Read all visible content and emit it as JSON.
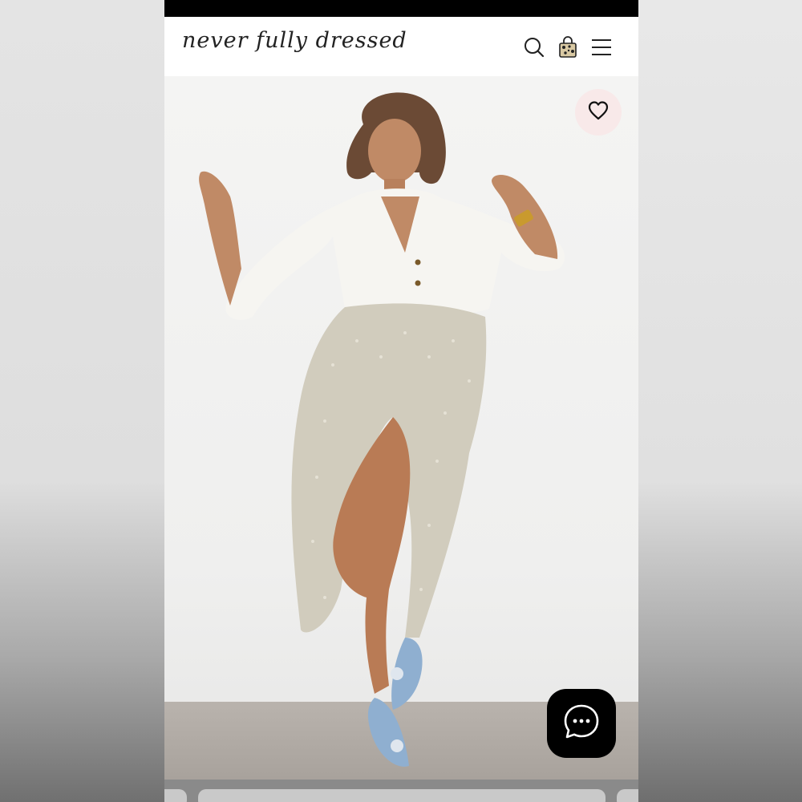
{
  "brand": {
    "logo_text": "never fully dressed"
  },
  "header": {
    "icons": [
      "search-icon",
      "shopping-bag-icon",
      "menu-icon"
    ]
  },
  "product": {
    "wishlist_icon": "heart-icon"
  },
  "chat": {
    "icon": "chat-bubble-icon"
  },
  "colors": {
    "promo_bar": "#000000",
    "wishlist_bg": "#f8e9e9",
    "chat_bg": "#000000"
  }
}
